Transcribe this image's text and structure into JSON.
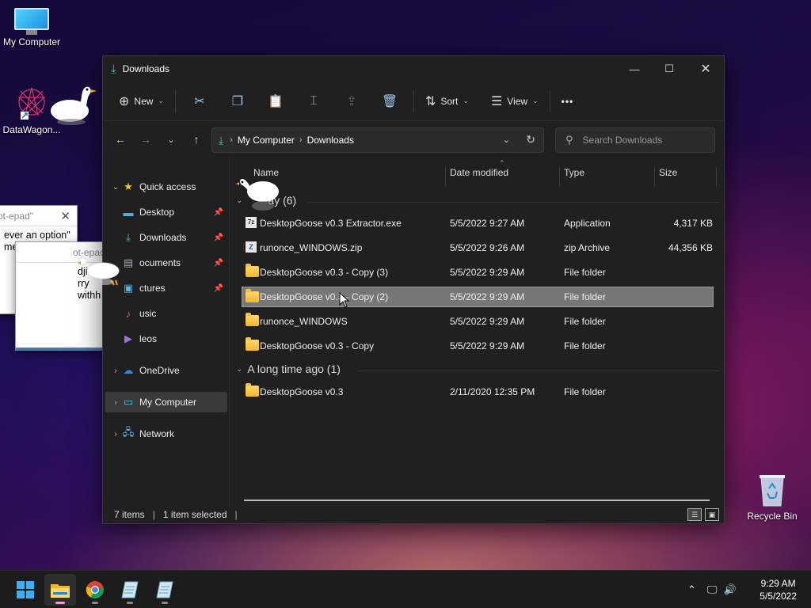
{
  "desktop": {
    "icons": [
      {
        "label": "My Computer",
        "icon": "monitor-icon"
      },
      {
        "label": "DataWagon...",
        "icon": "datawagon-icon"
      },
      {
        "label": "Recycle Bin",
        "icon": "recycle-bin-icon"
      }
    ]
  },
  "notepads": [
    {
      "title": "ot-epad\"",
      "lines": [
        "ever an option\"",
        "me)"
      ]
    },
    {
      "title": "ot-epad\"",
      "lines": [
        "dji",
        "rry",
        "withh feet"
      ]
    }
  ],
  "explorer": {
    "title": "Downloads",
    "toolbar": {
      "new_label": "New",
      "sort_label": "Sort",
      "view_label": "View",
      "more_label": "•••"
    },
    "address": {
      "crumbs": [
        "My Computer",
        "Downloads"
      ]
    },
    "search_placeholder": "Search Downloads",
    "sidebar": [
      {
        "label": "Quick access",
        "icon": "star-icon"
      },
      {
        "label": "Desktop",
        "icon": "desktop-folder-icon"
      },
      {
        "label": "Downloads",
        "icon": "download-icon"
      },
      {
        "label": "ocuments",
        "icon": "documents-icon"
      },
      {
        "label": "ctures",
        "icon": "pictures-icon"
      },
      {
        "label": "usic",
        "icon": "music-icon"
      },
      {
        "label": "leos",
        "icon": "videos-icon"
      },
      {
        "label": "OneDrive",
        "icon": "cloud-icon"
      },
      {
        "label": "My Computer",
        "icon": "monitor-icon"
      },
      {
        "label": "Network",
        "icon": "network-icon"
      }
    ],
    "columns": {
      "name": "Name",
      "date": "Date modified",
      "type": "Type",
      "size": "Size"
    },
    "groups": [
      {
        "label": "ay (6)",
        "files": [
          {
            "name": "DesktopGoose v0.3 Extractor.exe",
            "date": "5/5/2022 9:27 AM",
            "type": "Application",
            "size": "4,317 KB",
            "icon": "exe"
          },
          {
            "name": "runonce_WINDOWS.zip",
            "date": "5/5/2022 9:26 AM",
            "type": "zip Archive",
            "size": "44,356 KB",
            "icon": "zip"
          },
          {
            "name": "DesktopGoose v0.3 - Copy (3)",
            "date": "5/5/2022 9:29 AM",
            "type": "File folder",
            "size": "",
            "icon": "folder"
          },
          {
            "name": "DesktopGoose v0.3 - Copy (2)",
            "date": "5/5/2022 9:29 AM",
            "type": "File folder",
            "size": "",
            "icon": "folder"
          },
          {
            "name": "runonce_WINDOWS",
            "date": "5/5/2022 9:29 AM",
            "type": "File folder",
            "size": "",
            "icon": "folder"
          },
          {
            "name": "DesktopGoose v0.3 - Copy",
            "date": "5/5/2022 9:29 AM",
            "type": "File folder",
            "size": "",
            "icon": "folder"
          }
        ]
      },
      {
        "label": "A long time ago (1)",
        "files": [
          {
            "name": "DesktopGoose v0.3",
            "date": "2/11/2020 12:35 PM",
            "type": "File folder",
            "size": "",
            "icon": "folder"
          }
        ]
      }
    ],
    "selected_file": "DesktopGoose v0.3 - Copy (2)",
    "status": {
      "items": "7 items",
      "selected": "1 item selected"
    }
  },
  "taskbar": {
    "apps": [
      "start-icon",
      "file-explorer-icon",
      "chrome-icon",
      "notepad-app-icon",
      "notepad-app-icon"
    ],
    "active_app": "file-explorer-icon",
    "clock": {
      "time": "9:29 AM",
      "date": "5/5/2022"
    }
  },
  "colors": {
    "accent": "#4cc2ff",
    "folder": "#f2b632",
    "window_bg": "#202020"
  }
}
